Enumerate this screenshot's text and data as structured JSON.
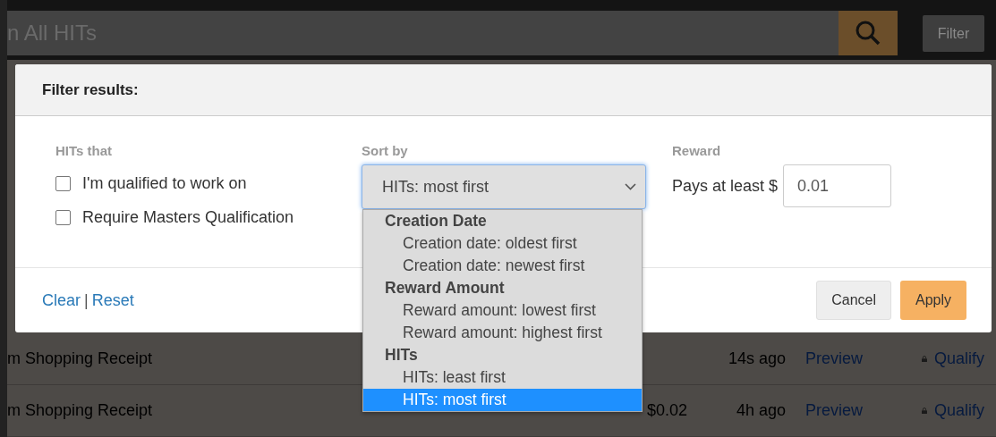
{
  "search": {
    "placeholder": "n All HITs"
  },
  "filter_button": "Filter",
  "rows": [
    {
      "title": "m Shopping Receipt",
      "age": "14s ago",
      "preview": "Preview",
      "qualify": "Qualify"
    },
    {
      "title": "m Shopping Receipt",
      "reward": "$0.02",
      "age": "4h ago",
      "preview": "Preview",
      "qualify": "Qualify"
    }
  ],
  "filter": {
    "title": "Filter results:",
    "hits_that": {
      "label": "HITs that",
      "options": [
        {
          "label": "I'm qualified to work on",
          "checked": false
        },
        {
          "label": "Require Masters Qualification",
          "checked": false
        }
      ]
    },
    "sort_by": {
      "label": "Sort by",
      "value": "HITs: most first",
      "expanded": true,
      "groups": [
        {
          "label": "Creation Date",
          "options": [
            {
              "label": "Creation date: oldest first",
              "selected": false
            },
            {
              "label": "Creation date: newest first",
              "selected": false
            }
          ]
        },
        {
          "label": "Reward Amount",
          "options": [
            {
              "label": "Reward amount: lowest first",
              "selected": false
            },
            {
              "label": "Reward amount: highest first",
              "selected": false
            }
          ]
        },
        {
          "label": "HITs",
          "options": [
            {
              "label": "HITs: least first",
              "selected": false
            },
            {
              "label": "HITs: most first",
              "selected": true
            }
          ]
        }
      ]
    },
    "reward": {
      "label": "Reward",
      "prefix": "Pays at least $",
      "value": "0.01"
    },
    "links": [
      "Clear",
      "Reset"
    ],
    "separator": "|",
    "buttons": [
      {
        "label": "Cancel",
        "kind": "secondary"
      },
      {
        "label": "Apply",
        "kind": "primary"
      }
    ]
  }
}
